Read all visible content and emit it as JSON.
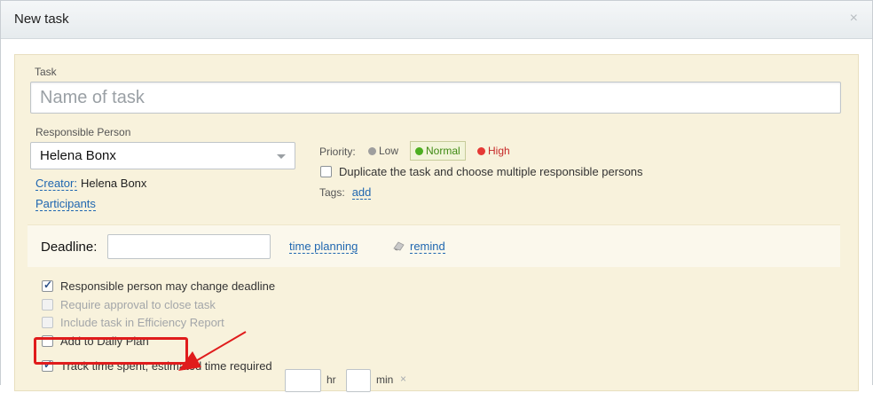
{
  "dialog": {
    "title": "New task",
    "close_glyph": "×"
  },
  "task": {
    "label": "Task",
    "placeholder": "Name of task"
  },
  "responsible": {
    "label": "Responsible Person",
    "selected": "Helena Bonx"
  },
  "creator": {
    "label": "Creator:",
    "name": "Helena Bonx"
  },
  "participants_label": "Participants",
  "priority": {
    "label": "Priority:",
    "options": [
      {
        "label": "Low",
        "color": "#9e9e9e"
      },
      {
        "label": "Normal",
        "color": "#4caf20",
        "selected": true
      },
      {
        "label": "High",
        "color": "#e53935"
      }
    ]
  },
  "duplicate_label": "Duplicate the task and choose multiple responsible persons",
  "tags": {
    "label": "Tags:",
    "add_label": "add"
  },
  "deadline": {
    "label": "Deadline:",
    "value": "",
    "time_planning_label": "time planning",
    "remind_label": "remind"
  },
  "options": [
    {
      "label": "Responsible person may change deadline",
      "checked": true,
      "disabled": false
    },
    {
      "label": "Require approval to close task",
      "checked": false,
      "disabled": true
    },
    {
      "label": "Include task in Efficiency Report",
      "checked": false,
      "disabled": true
    },
    {
      "label": "Add to Daily Plan",
      "checked": false,
      "disabled": false
    },
    {
      "label": "Track time spent; estimated time required",
      "checked": true,
      "disabled": false
    }
  ],
  "time_estimate": {
    "hours_value": "",
    "hours_unit": "hr",
    "minutes_value": "",
    "minutes_unit": "min",
    "clear_glyph": "×"
  },
  "annotation": {
    "highlight_color": "#e01c1c"
  },
  "colors": {
    "panel_bg": "#f8f2dc",
    "link": "#2067b0"
  }
}
